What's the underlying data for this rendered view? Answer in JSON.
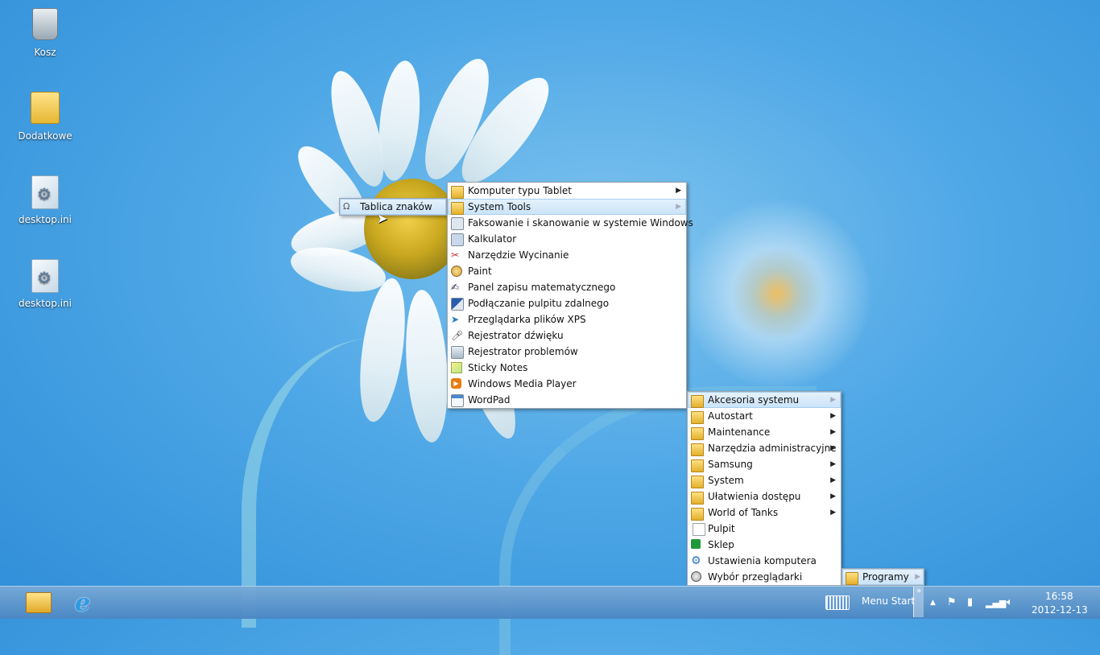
{
  "desktop": {
    "icons": [
      {
        "label": "Kosz",
        "icon": "recycle-bin-icon"
      },
      {
        "label": "Dodatkowe",
        "icon": "folder-icon"
      },
      {
        "label": "desktop.ini",
        "icon": "settings-file-icon"
      },
      {
        "label": "desktop.ini",
        "icon": "settings-file-icon"
      }
    ]
  },
  "menus": {
    "system_tools": {
      "items": [
        {
          "label": "Tablica znaków",
          "icon": "character-map-icon"
        }
      ]
    },
    "accessories": {
      "items": [
        {
          "label": "Komputer typu Tablet",
          "icon": "folder-icon",
          "submenu": true
        },
        {
          "label": "System Tools",
          "icon": "folder-icon",
          "submenu": true
        },
        {
          "label": "Faksowanie i skanowanie w systemie Windows",
          "icon": "fax-icon"
        },
        {
          "label": "Kalkulator",
          "icon": "calculator-icon"
        },
        {
          "label": "Narzędzie Wycinanie",
          "icon": "snipping-tool-icon"
        },
        {
          "label": "Paint",
          "icon": "paint-icon"
        },
        {
          "label": "Panel zapisu matematycznego",
          "icon": "math-input-icon"
        },
        {
          "label": "Podłączanie pulpitu zdalnego",
          "icon": "remote-desktop-icon"
        },
        {
          "label": "Przeglądarka plików XPS",
          "icon": "xps-viewer-icon"
        },
        {
          "label": "Rejestrator dźwięku",
          "icon": "microphone-icon"
        },
        {
          "label": "Rejestrator problemów",
          "icon": "steps-recorder-icon"
        },
        {
          "label": "Sticky Notes",
          "icon": "sticky-notes-icon"
        },
        {
          "label": "Windows Media Player",
          "icon": "media-player-icon"
        },
        {
          "label": "WordPad",
          "icon": "wordpad-icon"
        }
      ]
    },
    "programs": {
      "items": [
        {
          "label": "Akcesoria systemu",
          "icon": "folder-icon",
          "submenu": true
        },
        {
          "label": "Autostart",
          "icon": "folder-icon",
          "submenu": true
        },
        {
          "label": "Maintenance",
          "icon": "folder-icon",
          "submenu": true
        },
        {
          "label": "Narzędzia administracyjne",
          "icon": "folder-icon",
          "submenu": true
        },
        {
          "label": "Samsung",
          "icon": "folder-icon",
          "submenu": true
        },
        {
          "label": "System",
          "icon": "folder-icon",
          "submenu": true
        },
        {
          "label": "Ułatwienia dostępu",
          "icon": "folder-icon",
          "submenu": true
        },
        {
          "label": "World of Tanks",
          "icon": "folder-icon",
          "submenu": true
        },
        {
          "label": "Pulpit",
          "icon": "document-icon"
        },
        {
          "label": "Sklep",
          "icon": "store-icon"
        },
        {
          "label": "Ustawienia komputera",
          "icon": "gear-icon"
        },
        {
          "label": "Wybór przeglądarki",
          "icon": "globe-icon"
        }
      ]
    },
    "root": {
      "items": [
        {
          "label": "Programy",
          "icon": "folder-icon",
          "submenu": true
        }
      ]
    }
  },
  "taskbar": {
    "start_label": "Menu Start",
    "chevron": "»",
    "time": "16:58",
    "date": "2012-12-13"
  },
  "colors": {
    "selection": "#c9e3f8",
    "taskbar": "#4b87c3",
    "wallpaper": "#4ea7e6"
  }
}
